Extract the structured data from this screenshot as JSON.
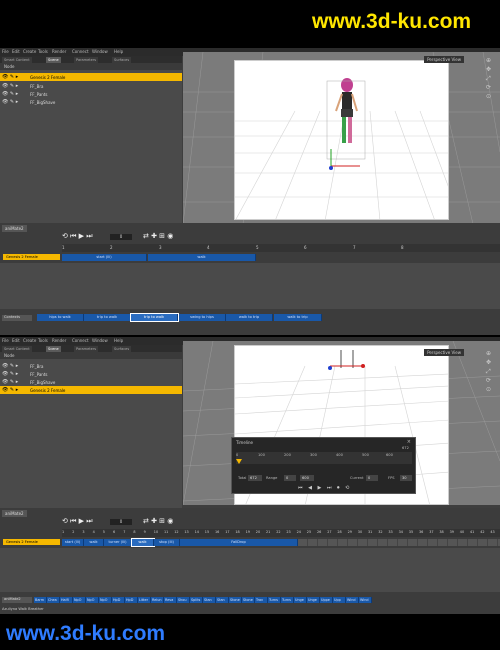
{
  "watermark": {
    "top": "www.3d-ku.com",
    "bottom": "www.3d-ku.com"
  },
  "menu": [
    "File",
    "Edit",
    "Create",
    "Tools",
    "Render",
    "Connect",
    "Window",
    "Help"
  ],
  "panel_tabs": [
    "Smart Content",
    "Scene",
    "Parameters",
    "Surfaces"
  ],
  "scene_header": "Node",
  "panel1": {
    "nodes": [
      "Genesis 2 Female",
      "FF_Bra",
      "FF_Pants",
      "FF_BigShave"
    ]
  },
  "panel2": {
    "nodes": [
      "FF_Bra",
      "FF_Pants",
      "FF_BigShave",
      "Genesis 2 Female"
    ]
  },
  "viewport_label": "Perspective View",
  "animate_tab": "aniMate2",
  "panel1_anim": {
    "track": "Genesis 2 Female",
    "ticks": [
      "1",
      "2",
      "3",
      "4",
      "5",
      "6",
      "7",
      "8"
    ],
    "blocks": [
      "start (lli)",
      "walk"
    ],
    "filter_label": "Contexts",
    "presets": [
      "hips to walk",
      "trip to walk",
      "trip to walk",
      "swing to hips",
      "walk to trip",
      "walk to trip"
    ]
  },
  "panel2_anim": {
    "track": "Genesis 2 Female",
    "ticks": [
      "1",
      "2",
      "3",
      "4",
      "5",
      "6",
      "7",
      "8",
      "9",
      "10",
      "11",
      "12",
      "13",
      "14",
      "15",
      "16",
      "17",
      "18",
      "19",
      "20",
      "21",
      "22",
      "23",
      "24",
      "25",
      "26",
      "27",
      "28",
      "29",
      "30",
      "31",
      "32",
      "33",
      "34",
      "35",
      "36",
      "37",
      "38",
      "39",
      "40",
      "41",
      "42",
      "43"
    ],
    "blocks": [
      "start (lli)",
      "walk",
      "turner (lli)",
      "walk",
      "stop (lli)",
      "FallDrop"
    ],
    "filter_label": "aniMate2",
    "presets": [
      "Barm",
      "Chea",
      "HalfI",
      "NpO",
      "NpO",
      "NpO",
      "HpD",
      "HpD",
      "Litter",
      "Relun",
      "Reva",
      "Shou",
      "Splits",
      "Stan",
      "Stan",
      "Stone",
      "Stone",
      "Trav",
      "Turns",
      "Turns",
      "Unge",
      "Unge",
      "Uppe",
      "Upp",
      "Wind",
      "Wind"
    ],
    "status": "Azuliyna Walk Breather"
  },
  "timeline": {
    "title": "Timeline",
    "ruler": [
      "0",
      "100",
      "200",
      "300",
      "400",
      "500",
      "600",
      "672"
    ],
    "total_label": "Total",
    "total": "672",
    "range_label": "Range",
    "range_start": "0",
    "range_end": "600",
    "current_label": "Current",
    "current": "0",
    "fps_label": "FPS",
    "fps": "30"
  },
  "colors": {
    "accent": "#f5b800",
    "block": "#1958a8"
  }
}
